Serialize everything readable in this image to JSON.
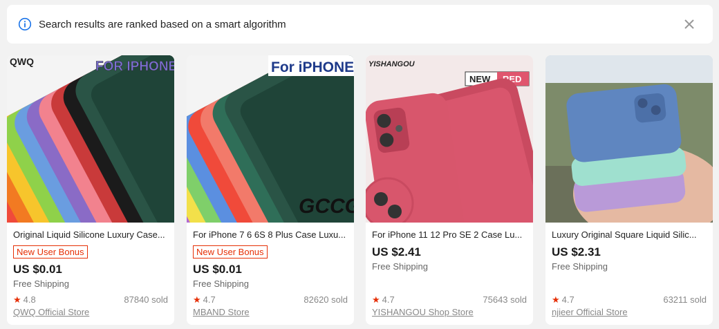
{
  "notice": {
    "text": "Search results are ranked based on a smart algorithm",
    "info_icon": "info-circle-icon",
    "close_icon": "close-icon",
    "accent": "#1a73e8"
  },
  "products": [
    {
      "image_brand": "QWQ",
      "image_caption": "FOR IPHONE",
      "title": "Original Liquid Silicone Luxury Case...",
      "bonus": "New User Bonus",
      "price": "US $0.01",
      "shipping": "Free Shipping",
      "rating": "4.8",
      "sold": "87840 sold",
      "store": "QWQ Official Store"
    },
    {
      "image_caption": "For iPHONE",
      "image_watermark": "GCCG",
      "title": "For iPhone 7 6 6S 8 Plus Case Luxu...",
      "bonus": "New User Bonus",
      "price": "US $0.01",
      "shipping": "Free Shipping",
      "rating": "4.7",
      "sold": "82620 sold",
      "store": "MBAND Store"
    },
    {
      "image_brand": "YISHANGOU",
      "image_tag_new": "NEW",
      "image_tag_color": "RED",
      "title": "For iPhone 11 12 Pro SE 2 Case Lu...",
      "price": "US $2.41",
      "shipping": "Free Shipping",
      "rating": "4.7",
      "sold": "75643 sold",
      "store": "YISHANGOU Shop Store"
    },
    {
      "title": "Luxury Original Square Liquid Silic...",
      "price": "US $2.31",
      "shipping": "Free Shipping",
      "rating": "4.7",
      "sold": "63211 sold",
      "store": "njieer Official Store"
    }
  ],
  "colors": {
    "brand_red": "#e62e04",
    "price": "#191919",
    "muted": "#888888"
  }
}
